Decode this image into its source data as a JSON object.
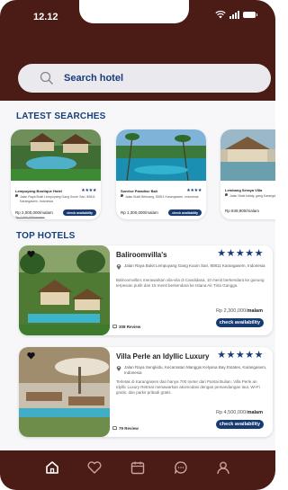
{
  "status_bar": {
    "time": "12.12"
  },
  "search": {
    "placeholder": "Search hotel"
  },
  "latest_searches": {
    "title": "LATEST SEARCHES",
    "cards": [
      {
        "name": "Lempuyang Boutique Hotel",
        "stars": "★★★★",
        "address": "Jalan Raya Bukit Lempuyang Gang Kuum Sari, 80811 Karangasem, Indonesia",
        "price": "Rp 2,000,000/malam",
        "price_old": "Rp 2,500,000/malam",
        "button": "check availability"
      },
      {
        "name": "Sunrise Paradise Bali",
        "stars": "★★★★",
        "address": "Jalan Bukit Bebuang, 80811 Karangasem, Indonesia",
        "price": "Rp 1,300,000/malam",
        "price_old": "",
        "button": "check availability"
      },
      {
        "name": "Lembang Seraya Villa",
        "stars": "",
        "address": "Jalan Selat Istiaty, gang Karangasem, Indonesia",
        "price": "Rp 849,900/malam",
        "price_old": "",
        "button": ""
      }
    ]
  },
  "top_hotels": {
    "title": "TOP HOTELS",
    "hotels": [
      {
        "name": "Baliroomvilla's",
        "stars": "★★★★★",
        "address": "Jalan Raya Bukit Lempuyang Gang Kuum Sari, 80811 Karangasem, Indonesia",
        "description": "Baliroomvilla's merawarkan vila-vila di Candidasa, 10 menit berkendara ke gunung terpesian putih dan 15 menit berkendara ke Istana Air Tirta Gangga.",
        "price": "Rp 2,300,000/",
        "price_unit": "malam",
        "button": "check availability",
        "reviews": "308 Review"
      },
      {
        "name": "Villa Perle an Idyllic Luxury",
        "stars": "★★★★★",
        "address": "Jalan Raya Sengkidu, Kecamatan Manggis Kelyana Bay Estates, Karangasem, Indonesia",
        "description": "Terletak di Karangasem dan hanya 700 meter dari Pantai Bulian, Villa Perle an Idyllic Luxury Retreat menawarkan akomodasi dengan pemandangan laut, Wi-Fi gratis, dan parkir pribadi gratis.",
        "price": "Rp 4,500,000/",
        "price_unit": "malam",
        "button": "check availability",
        "reviews": "79 Review"
      }
    ]
  },
  "nav": {
    "items": [
      "home-icon",
      "heart-icon",
      "calendar-icon",
      "chat-icon",
      "profile-icon"
    ]
  },
  "colors": {
    "header": "#4b1c16",
    "accent": "#173a73",
    "section_title": "#16407c"
  }
}
